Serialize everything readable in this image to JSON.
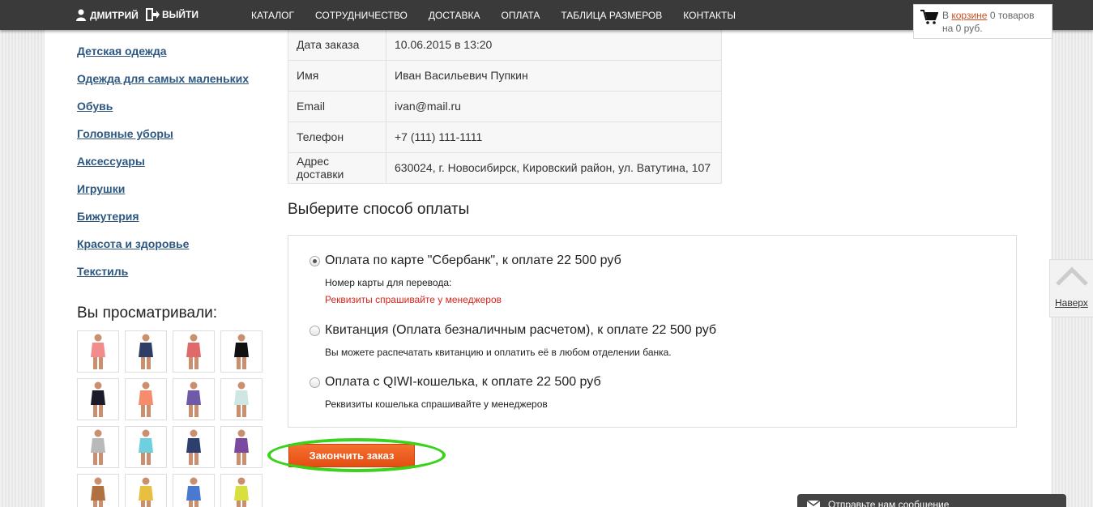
{
  "header": {
    "user_name": "ДМИТРИЙ",
    "logout_label": "ВЫЙТИ",
    "nav": [
      "КАТАЛОГ",
      "СОТРУДНИЧЕСТВО",
      "ДОСТАВКА",
      "ОПЛАТА",
      "ТАБЛИЦА РАЗМЕРОВ",
      "КОНТАКТЫ"
    ]
  },
  "cart": {
    "prefix": "В",
    "link": "корзине",
    "count": "0 товаров",
    "sum": "на 0 руб."
  },
  "sidebar": {
    "categories": [
      "Детская одежда",
      "Одежда для самых маленьких",
      "Обувь",
      "Головные уборы",
      "Аксессуары",
      "Игрушки",
      "Бижутерия",
      "Красота и здоровье",
      "Текстиль"
    ],
    "viewed_title": "Вы просматривали:"
  },
  "order": {
    "rows": [
      {
        "key": "Дата заказа",
        "value": "10.06.2015 в 13:20"
      },
      {
        "key": "Имя",
        "value": "Иван Васильевич Пупкин"
      },
      {
        "key": "Email",
        "value": "ivan@mail.ru"
      },
      {
        "key": "Телефон",
        "value": "+7 (111) 111-1111"
      },
      {
        "key": "Адрес доставки",
        "value": "630024, г. Новосибирск, Кировский район, ул. Ватутина, 107"
      }
    ]
  },
  "payment": {
    "title": "Выберите способ оплаты",
    "options": [
      {
        "label": "Оплата по карте \"Сбербанк\", к оплате 22 500 руб",
        "note": "Номер карты для перевода:",
        "note2": "Реквизиты спрашивайте у менеджеров",
        "selected": true
      },
      {
        "label": "Квитанция (Оплата безналичным расчетом), к оплате 22 500 руб",
        "note": "Вы можете распечатать квитанцию и оплатить её в любом отделении банка.",
        "selected": false
      },
      {
        "label": "Оплата с QIWI-кошелька, к оплате 22 500 руб",
        "note": "Реквизиты кошелька спрашивайте у менеджеров",
        "selected": false
      }
    ],
    "submit_label": "Закончить заказ"
  },
  "back_top_label": "Наверх",
  "message_bar": "Отправьте нам сообщение",
  "colors": {
    "accent": "#e54e14",
    "link": "#2e5780",
    "highlight": "#3bd21c",
    "topbar": "#3a3a3a"
  }
}
